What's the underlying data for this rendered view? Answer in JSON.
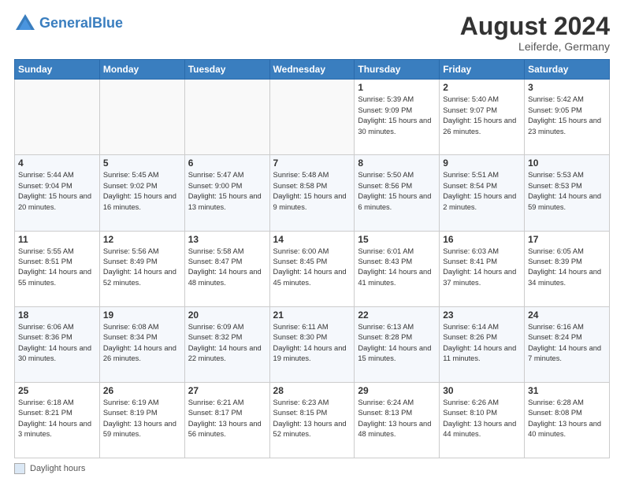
{
  "header": {
    "logo_line1": "General",
    "logo_line2": "Blue",
    "month": "August 2024",
    "location": "Leiferde, Germany"
  },
  "weekdays": [
    "Sunday",
    "Monday",
    "Tuesday",
    "Wednesday",
    "Thursday",
    "Friday",
    "Saturday"
  ],
  "footer": {
    "legend_label": "Daylight hours"
  },
  "weeks": [
    [
      {
        "day": "",
        "info": ""
      },
      {
        "day": "",
        "info": ""
      },
      {
        "day": "",
        "info": ""
      },
      {
        "day": "",
        "info": ""
      },
      {
        "day": "1",
        "info": "Sunrise: 5:39 AM\nSunset: 9:09 PM\nDaylight: 15 hours\nand 30 minutes."
      },
      {
        "day": "2",
        "info": "Sunrise: 5:40 AM\nSunset: 9:07 PM\nDaylight: 15 hours\nand 26 minutes."
      },
      {
        "day": "3",
        "info": "Sunrise: 5:42 AM\nSunset: 9:05 PM\nDaylight: 15 hours\nand 23 minutes."
      }
    ],
    [
      {
        "day": "4",
        "info": "Sunrise: 5:44 AM\nSunset: 9:04 PM\nDaylight: 15 hours\nand 20 minutes."
      },
      {
        "day": "5",
        "info": "Sunrise: 5:45 AM\nSunset: 9:02 PM\nDaylight: 15 hours\nand 16 minutes."
      },
      {
        "day": "6",
        "info": "Sunrise: 5:47 AM\nSunset: 9:00 PM\nDaylight: 15 hours\nand 13 minutes."
      },
      {
        "day": "7",
        "info": "Sunrise: 5:48 AM\nSunset: 8:58 PM\nDaylight: 15 hours\nand 9 minutes."
      },
      {
        "day": "8",
        "info": "Sunrise: 5:50 AM\nSunset: 8:56 PM\nDaylight: 15 hours\nand 6 minutes."
      },
      {
        "day": "9",
        "info": "Sunrise: 5:51 AM\nSunset: 8:54 PM\nDaylight: 15 hours\nand 2 minutes."
      },
      {
        "day": "10",
        "info": "Sunrise: 5:53 AM\nSunset: 8:53 PM\nDaylight: 14 hours\nand 59 minutes."
      }
    ],
    [
      {
        "day": "11",
        "info": "Sunrise: 5:55 AM\nSunset: 8:51 PM\nDaylight: 14 hours\nand 55 minutes."
      },
      {
        "day": "12",
        "info": "Sunrise: 5:56 AM\nSunset: 8:49 PM\nDaylight: 14 hours\nand 52 minutes."
      },
      {
        "day": "13",
        "info": "Sunrise: 5:58 AM\nSunset: 8:47 PM\nDaylight: 14 hours\nand 48 minutes."
      },
      {
        "day": "14",
        "info": "Sunrise: 6:00 AM\nSunset: 8:45 PM\nDaylight: 14 hours\nand 45 minutes."
      },
      {
        "day": "15",
        "info": "Sunrise: 6:01 AM\nSunset: 8:43 PM\nDaylight: 14 hours\nand 41 minutes."
      },
      {
        "day": "16",
        "info": "Sunrise: 6:03 AM\nSunset: 8:41 PM\nDaylight: 14 hours\nand 37 minutes."
      },
      {
        "day": "17",
        "info": "Sunrise: 6:05 AM\nSunset: 8:39 PM\nDaylight: 14 hours\nand 34 minutes."
      }
    ],
    [
      {
        "day": "18",
        "info": "Sunrise: 6:06 AM\nSunset: 8:36 PM\nDaylight: 14 hours\nand 30 minutes."
      },
      {
        "day": "19",
        "info": "Sunrise: 6:08 AM\nSunset: 8:34 PM\nDaylight: 14 hours\nand 26 minutes."
      },
      {
        "day": "20",
        "info": "Sunrise: 6:09 AM\nSunset: 8:32 PM\nDaylight: 14 hours\nand 22 minutes."
      },
      {
        "day": "21",
        "info": "Sunrise: 6:11 AM\nSunset: 8:30 PM\nDaylight: 14 hours\nand 19 minutes."
      },
      {
        "day": "22",
        "info": "Sunrise: 6:13 AM\nSunset: 8:28 PM\nDaylight: 14 hours\nand 15 minutes."
      },
      {
        "day": "23",
        "info": "Sunrise: 6:14 AM\nSunset: 8:26 PM\nDaylight: 14 hours\nand 11 minutes."
      },
      {
        "day": "24",
        "info": "Sunrise: 6:16 AM\nSunset: 8:24 PM\nDaylight: 14 hours\nand 7 minutes."
      }
    ],
    [
      {
        "day": "25",
        "info": "Sunrise: 6:18 AM\nSunset: 8:21 PM\nDaylight: 14 hours\nand 3 minutes."
      },
      {
        "day": "26",
        "info": "Sunrise: 6:19 AM\nSunset: 8:19 PM\nDaylight: 13 hours\nand 59 minutes."
      },
      {
        "day": "27",
        "info": "Sunrise: 6:21 AM\nSunset: 8:17 PM\nDaylight: 13 hours\nand 56 minutes."
      },
      {
        "day": "28",
        "info": "Sunrise: 6:23 AM\nSunset: 8:15 PM\nDaylight: 13 hours\nand 52 minutes."
      },
      {
        "day": "29",
        "info": "Sunrise: 6:24 AM\nSunset: 8:13 PM\nDaylight: 13 hours\nand 48 minutes."
      },
      {
        "day": "30",
        "info": "Sunrise: 6:26 AM\nSunset: 8:10 PM\nDaylight: 13 hours\nand 44 minutes."
      },
      {
        "day": "31",
        "info": "Sunrise: 6:28 AM\nSunset: 8:08 PM\nDaylight: 13 hours\nand 40 minutes."
      }
    ]
  ]
}
